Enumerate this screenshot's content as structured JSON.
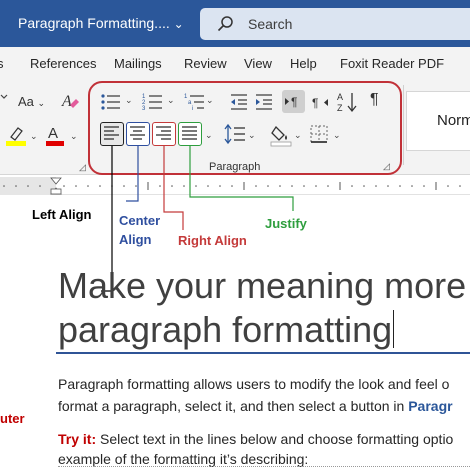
{
  "title_bar": {
    "doc_title": "Paragraph Formatting....",
    "dropdown_glyph": "⌄",
    "search_placeholder": "Search"
  },
  "menu": {
    "items": [
      "References",
      "Mailings",
      "Review",
      "View",
      "Help",
      "Foxit Reader PDF"
    ]
  },
  "ribbon": {
    "font_size_label": "Aa",
    "paragraph_group_label": "Paragraph",
    "style_preview": "Norm",
    "pilcrow": "¶"
  },
  "annotations": {
    "left_align": "Left Align",
    "center_align_1": "Center",
    "center_align_2": "Align",
    "right_align": "Right Align",
    "justify": "Justify",
    "margin_fragment": "uter"
  },
  "document": {
    "heading_line1": "Make your meaning more vis",
    "heading_line2": "paragraph formatting",
    "para1_line1": "Paragraph formatting allows users to modify the look and feel o",
    "para1_line2_pre": "format a paragraph, select it, and then select a button in ",
    "para1_line2_bold": "Paragr",
    "tryit_label": "Try it:",
    "tryit_text": " Select text in the lines below and choose formatting optio",
    "tryit_line2": "example of the formatting it’s describing:"
  },
  "colors": {
    "title_bar": "#2b579a",
    "highlight_box": "#c13138",
    "left_align_line": "#000000",
    "center_align": "#2f4f9f",
    "right_align": "#c43a3a",
    "justify": "#2e9e3e"
  }
}
